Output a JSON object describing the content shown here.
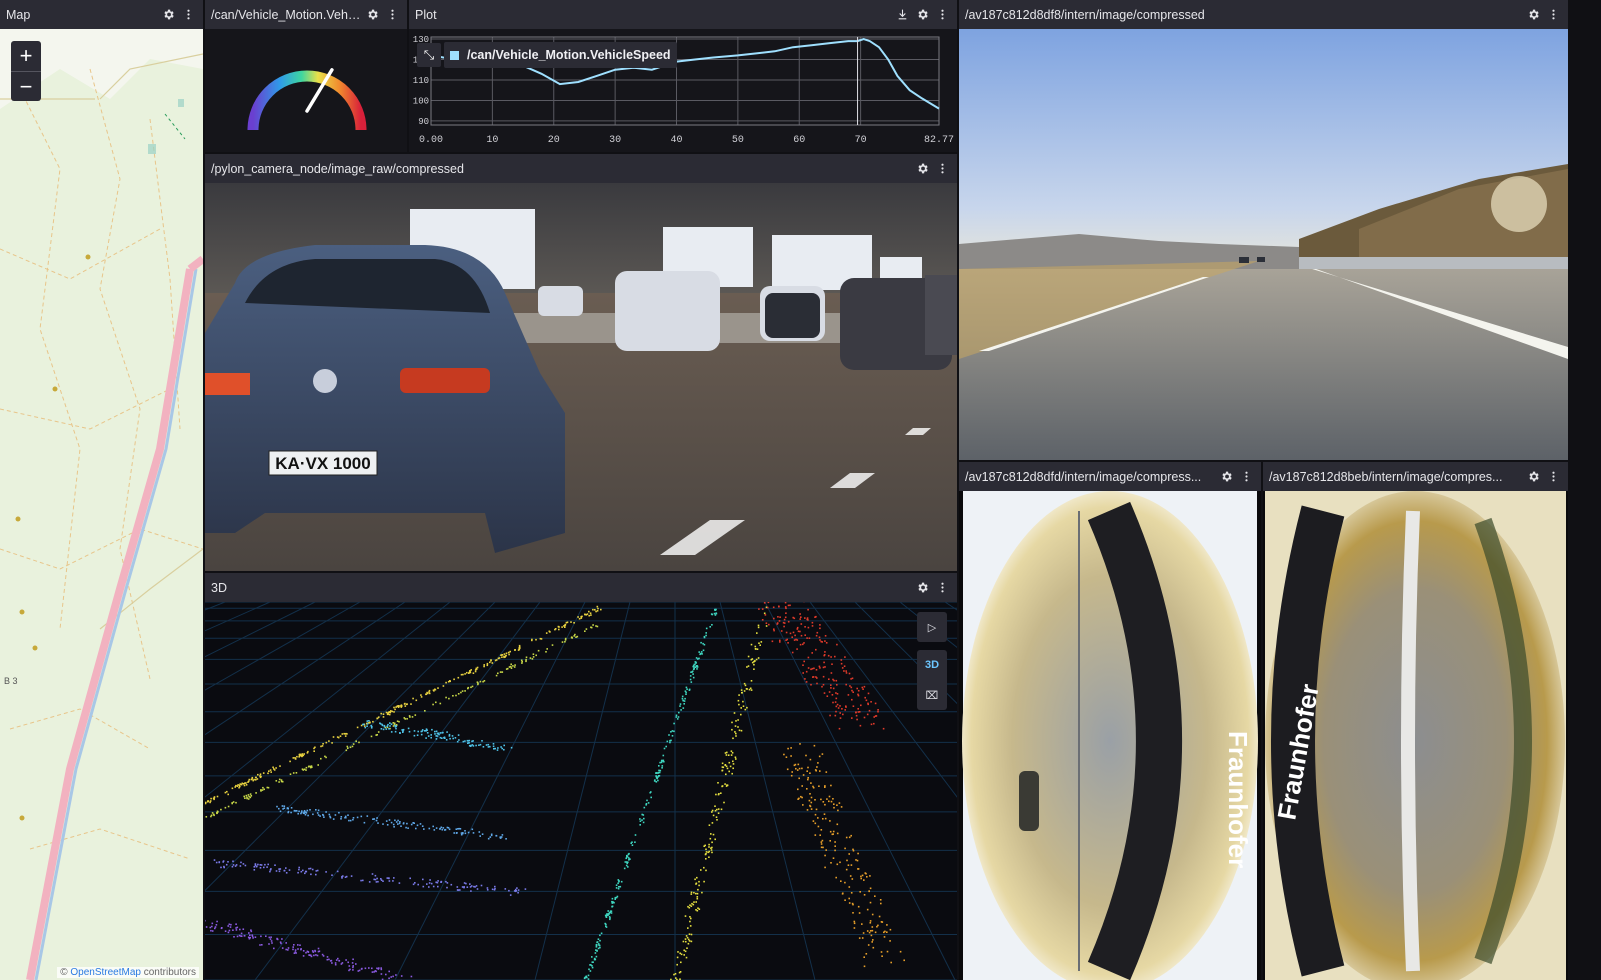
{
  "panels": {
    "map": {
      "title": "Map",
      "zoom_in": "+",
      "zoom_out": "−",
      "attribution_prefix": "© ",
      "attribution_link": "OpenStreetMap",
      "attribution_suffix": " contributors",
      "road_label": "B 3"
    },
    "gauge": {
      "title": "/can/Vehicle_Motion.Vehi..."
    },
    "plot": {
      "title": "Plot",
      "legend_label": "/can/Vehicle_Motion.VehicleSpeed",
      "collapse_icon": "⤡"
    },
    "camera_raw": {
      "title": "/pylon_camera_node/image_raw/compressed",
      "plate": "KA·VX 1000"
    },
    "scene3d": {
      "title": "3D",
      "tool_select": "▷",
      "tool_3d": "3D",
      "tool_measure": "⌧"
    },
    "cam_df8": {
      "title": "/av187c812d8df8/intern/image/compressed"
    },
    "cam_dfd": {
      "title": "/av187c812d8dfd/intern/image/compress...",
      "logo_text": "Fraunhofer"
    },
    "cam_beb": {
      "title": "/av187c812d8beb/intern/image/compres...",
      "logo_text": "Fraunhofer"
    }
  },
  "icons": {
    "settings": "gear-icon",
    "menu": "kebab-icon",
    "download": "download-icon"
  },
  "colors": {
    "panel_header": "#2b2b34",
    "series": "#9fe0ff",
    "accent": "#6cc6ff"
  },
  "gauge_value": 0.62,
  "chart_data": {
    "type": "line",
    "series": [
      {
        "name": "/can/Vehicle_Motion.VehicleSpeed",
        "x": [
          0,
          2,
          5,
          8,
          11,
          13,
          15,
          18,
          21,
          24,
          27,
          30,
          33,
          36,
          38,
          40,
          43,
          46,
          50,
          53,
          56,
          59,
          62,
          65,
          68,
          69.5,
          70.5,
          71.5,
          73,
          74.5,
          76,
          78,
          80,
          82.77
        ],
        "values": [
          122,
          121,
          120,
          122,
          120,
          118,
          117,
          113,
          108,
          109,
          112,
          115,
          116,
          115,
          117,
          119,
          120,
          121,
          122,
          123,
          124,
          126,
          127,
          128,
          129,
          129,
          130,
          129,
          126,
          120,
          112,
          105,
          101,
          96
        ]
      }
    ],
    "xticks": [
      "0.00",
      "10",
      "20",
      "30",
      "40",
      "50",
      "60",
      "70",
      "82.77"
    ],
    "yticks": [
      "90",
      "100",
      "110",
      "120",
      "130"
    ],
    "xlim": [
      0,
      82.77
    ],
    "ylim": [
      88,
      131
    ],
    "grid": true
  }
}
